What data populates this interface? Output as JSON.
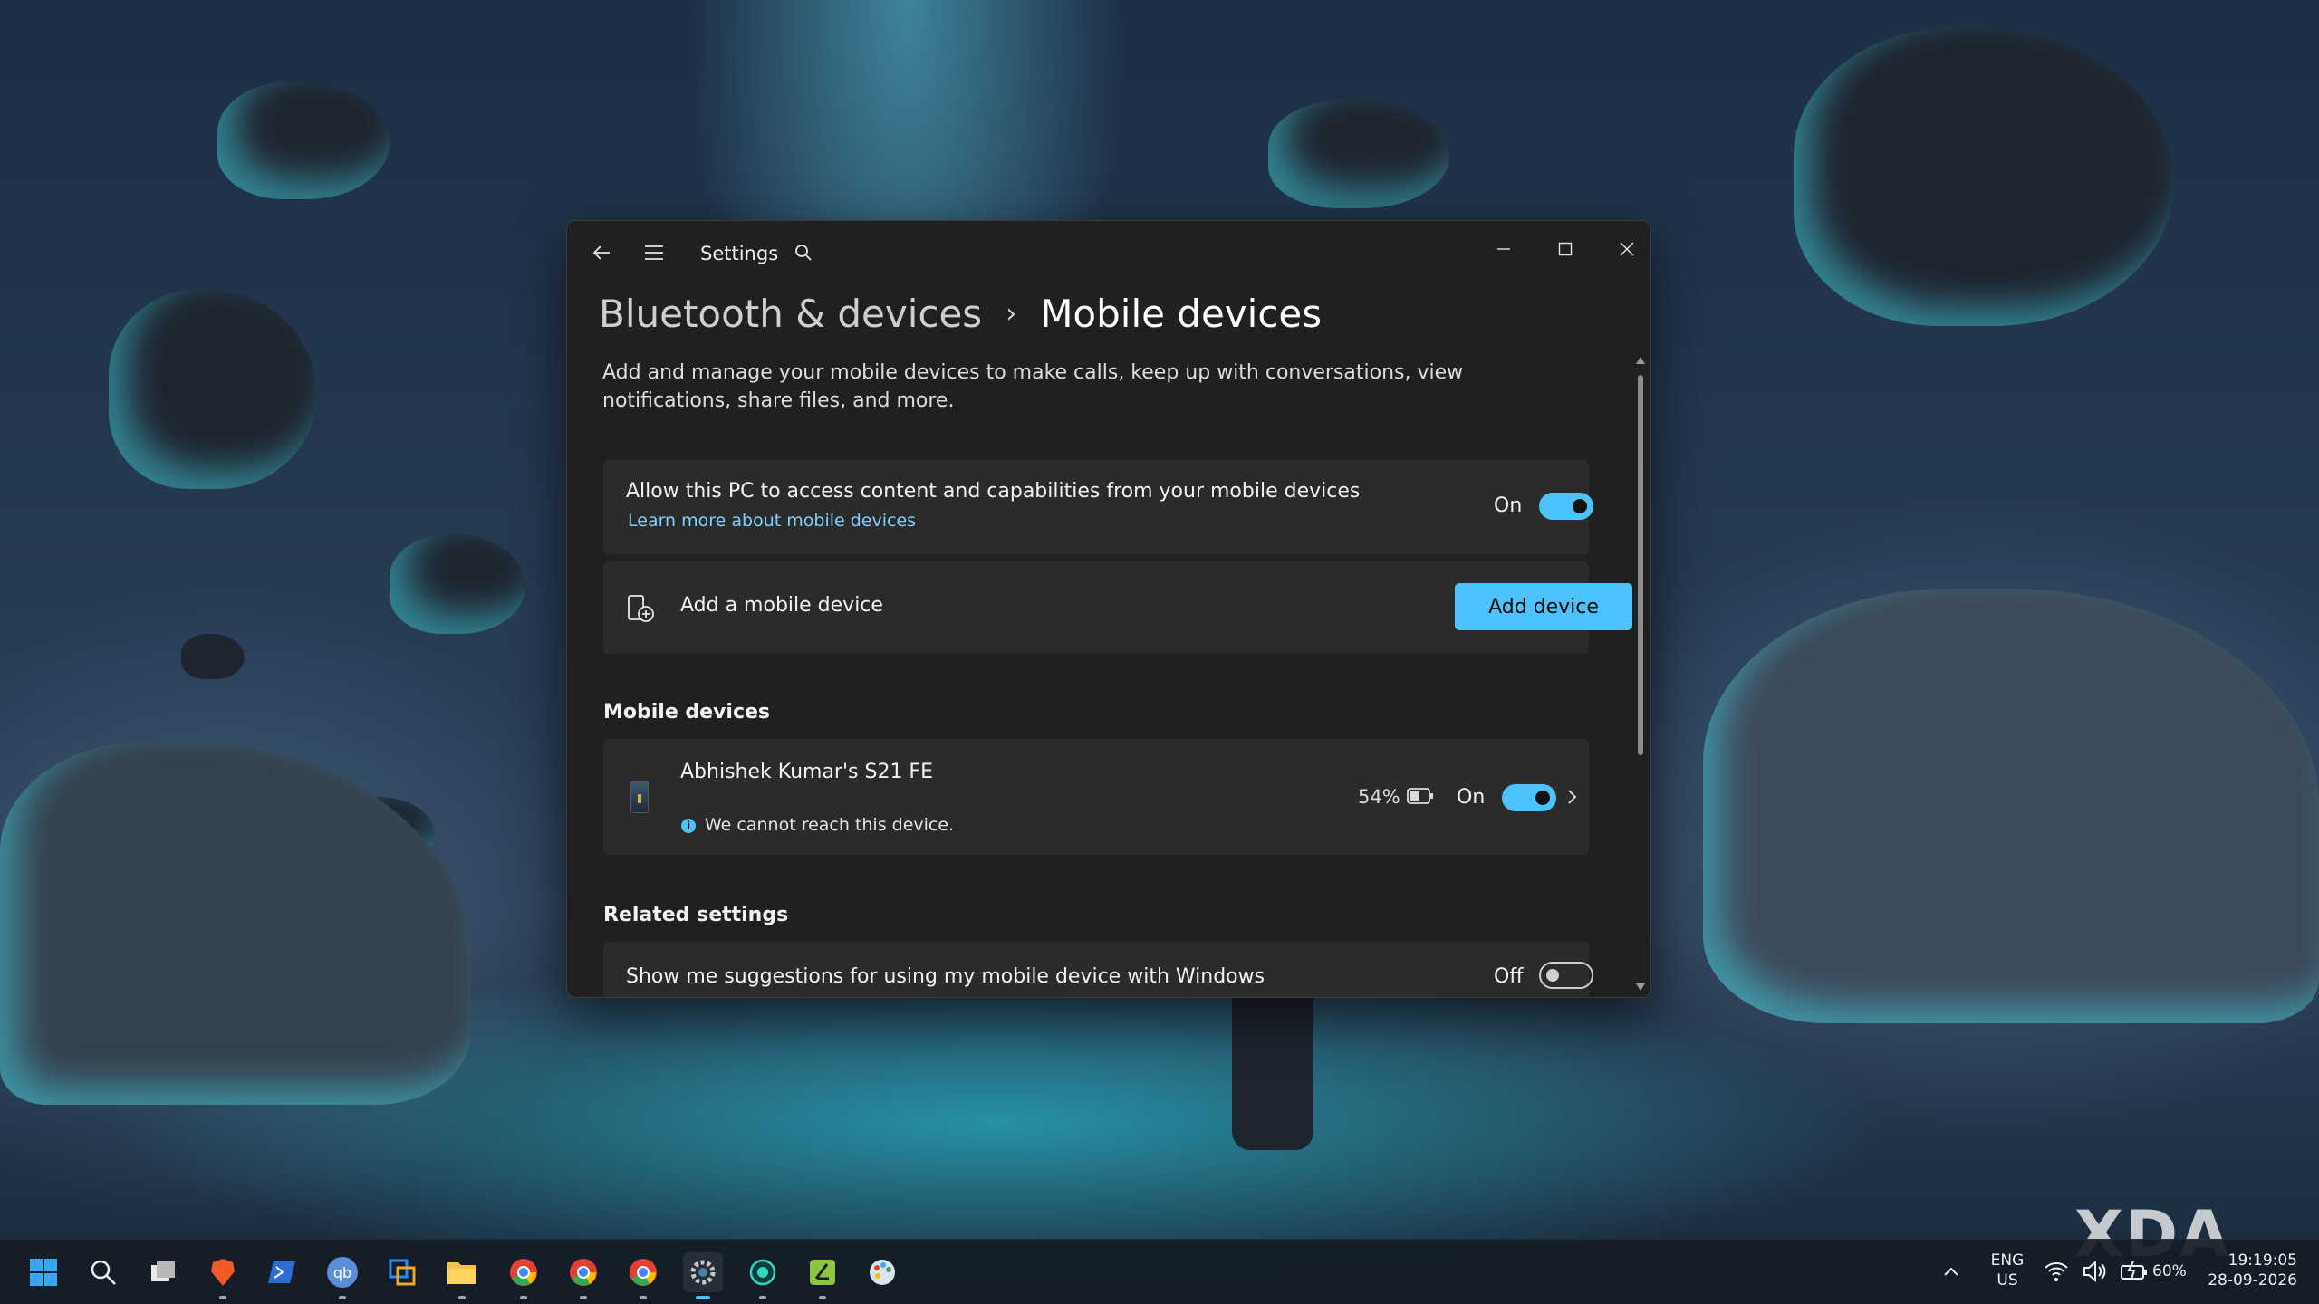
{
  "window": {
    "app_title": "Settings",
    "breadcrumb": {
      "parent": "Bluetooth & devices",
      "separator": "›",
      "current": "Mobile devices"
    },
    "description": "Add and manage your mobile devices to make calls, keep up with conversations, view notifications, share files, and more.",
    "allow_card": {
      "title": "Allow this PC to access content and capabilities from your mobile devices",
      "link": "Learn more about mobile devices",
      "state": "On"
    },
    "add_card": {
      "title": "Add a mobile device",
      "button": "Add device"
    },
    "mobile_devices": {
      "heading": "Mobile devices",
      "items": [
        {
          "name": "Abhishek Kumar's S21 FE",
          "status": "We cannot reach this device.",
          "battery": "54%",
          "state": "On"
        }
      ]
    },
    "related_settings": {
      "heading": "Related settings",
      "items": [
        {
          "title": "Show me suggestions for using my mobile device with Windows",
          "state": "Off"
        }
      ]
    }
  },
  "taskbar": {
    "apps": [
      "windows-start",
      "search",
      "task-view",
      "brave",
      "powershell",
      "qbittorrent",
      "virtualbox",
      "file-explorer",
      "chrome-1",
      "chrome-2",
      "chrome-3",
      "settings",
      "app-circle",
      "app-green",
      "paint"
    ],
    "tray": {
      "language": "ENG",
      "region": "US",
      "battery": "60%",
      "time": "19:19:05",
      "date": "28-09-2026"
    }
  },
  "watermark": "XDA",
  "colors": {
    "accent": "#4cc2ff",
    "window_bg": "#202020",
    "card_bg": "#2b2b2b"
  }
}
